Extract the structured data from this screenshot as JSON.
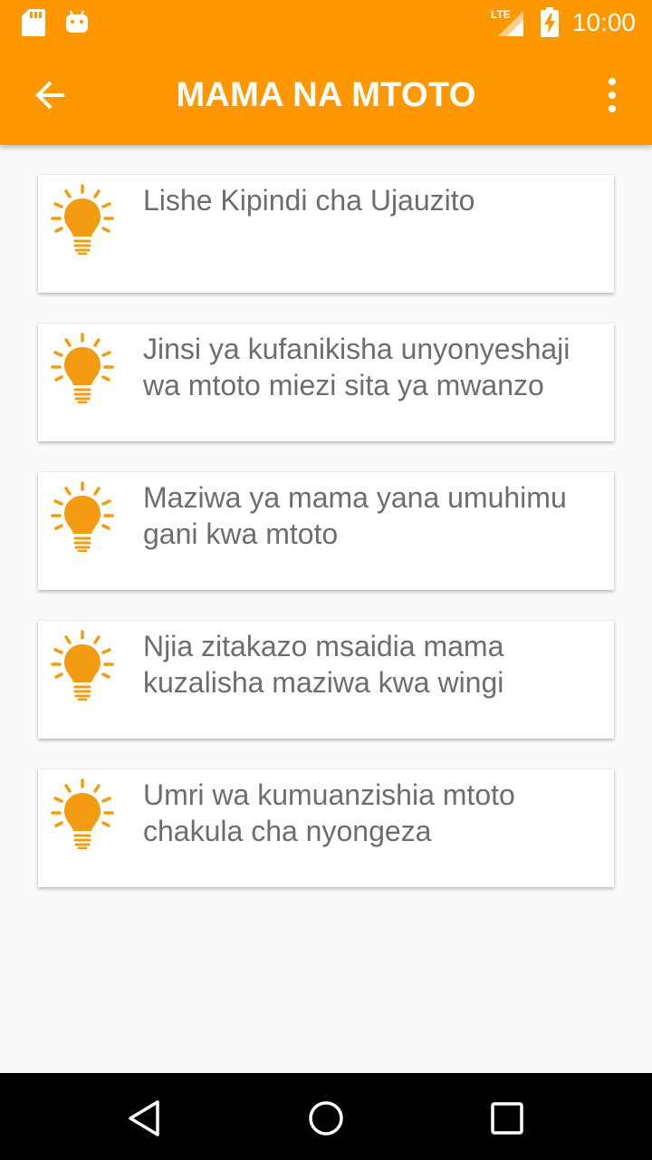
{
  "status_bar": {
    "time": "10:00",
    "network_label": "LTE",
    "icons": [
      "sd-card-icon",
      "android-icon",
      "signal-icon",
      "battery-charging-icon"
    ]
  },
  "toolbar": {
    "title": "MAMA NA MTOTO",
    "back_icon": "arrow-left-icon",
    "menu_icon": "more-vert-icon"
  },
  "topics": [
    {
      "title": "Lishe Kipindi cha Ujauzito",
      "icon": "lightbulb-icon"
    },
    {
      "title": "Jinsi ya kufanikisha unyonyeshaji wa mtoto miezi sita ya mwanzo",
      "icon": "lightbulb-icon"
    },
    {
      "title": "Maziwa ya mama yana umuhimu gani kwa mtoto",
      "icon": "lightbulb-icon"
    },
    {
      "title": "Njia zitakazo msaidia mama kuzalisha maziwa kwa wingi",
      "icon": "lightbulb-icon"
    },
    {
      "title": "Umri wa kumuanzishia mtoto chakula cha nyongeza",
      "icon": "lightbulb-icon"
    }
  ],
  "colors": {
    "primary": "#ff9800",
    "bulb": "#f39c12",
    "background": "#fafafa",
    "card_text": "#6d6d6d"
  },
  "nav_bar": {
    "icons": [
      "back-triangle-icon",
      "home-circle-icon",
      "recents-square-icon"
    ]
  }
}
